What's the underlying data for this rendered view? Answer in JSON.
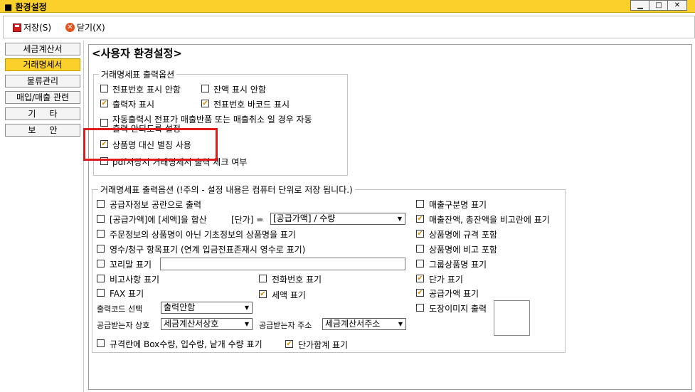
{
  "window": {
    "title": "환경설정"
  },
  "toolbar": {
    "save_label": "저장(S)",
    "close_label": "닫기(X)"
  },
  "nav": {
    "items": [
      {
        "label": "세금계산서",
        "active": false
      },
      {
        "label": "거래명세서",
        "active": true
      },
      {
        "label": "물류관리",
        "active": false
      },
      {
        "label": "매입/매출 관련",
        "active": false
      },
      {
        "label": "기     타",
        "active": false
      },
      {
        "label": "보     안",
        "active": false
      }
    ]
  },
  "page_title": "<사용자 환경설정>",
  "group1": {
    "legend": "거래명세표 출력옵션",
    "opts": {
      "no_slip_no": {
        "label": "전표번호 표시 안함",
        "checked": false
      },
      "no_balance": {
        "label": "잔액 표시 안함",
        "checked": false
      },
      "printer_show": {
        "label": "출력자 표시",
        "checked": true
      },
      "slip_barcode": {
        "label": "전표번호 바코드 표시",
        "checked": true
      },
      "auto_print": {
        "label": "자동출력시 전표가 매출반품 또는 매출취소 일 경우 자동",
        "checked": false
      },
      "auto_print_2": "출력 안되도록 설정",
      "alias": {
        "label": "상품명 대신 별칭 사용",
        "checked": true
      },
      "pdf_check": {
        "label": "pdf저장시 거래명세서 출력 체크 여부",
        "checked": false
      }
    }
  },
  "group2": {
    "legend": "거래명세표 출력옵션 (!주의 - 설정 내용은 컴퓨터 단위로 저장 됩니다.)",
    "left": {
      "supplier_blank": {
        "label": "공급자정보 공란으로 출력",
        "checked": false
      },
      "sum_amount": {
        "label": "[공급가액]에 [세액]을 합산",
        "checked": false
      },
      "unit_price_label": "[단가] =",
      "unit_price_formula": "[공급가액] / 수량",
      "order_basic_name": {
        "label": "주문정보의 상품명이 아닌 기초정보의 상품명을 표기",
        "checked": false
      },
      "receipt_claim": {
        "label": "영수/청구 항목표기 (연계 입금전표존재시 영수로 표기)",
        "checked": false
      },
      "footer_label": {
        "label": "꼬리말 표기",
        "checked": false
      },
      "footer_value": "",
      "remarks": {
        "label": "비고사항 표기",
        "checked": false
      },
      "phone": {
        "label": "전화번호 표기",
        "checked": false
      },
      "fax": {
        "label": "FAX 표기",
        "checked": false
      },
      "tax": {
        "label": "세액 표기",
        "checked": true
      },
      "print_code_label": "출력코드 선택",
      "print_code_value": "출력안함",
      "recv_name_label": "공급받는자 상호",
      "recv_name_value": "세금계산서상호",
      "recv_addr_label": "공급받는자 주소",
      "recv_addr_value": "세금계산서주소",
      "box_qty": {
        "label": "규격란에 Box수량, 입수량, 낱개 수량 표기",
        "checked": false
      },
      "unit_total": {
        "label": "단가합계 표기",
        "checked": true
      }
    },
    "right": {
      "sales_type": {
        "label": "매출구분명 표기",
        "checked": false
      },
      "balance_compare": {
        "label": "매출잔액, 총잔액을 비고란에 표기",
        "checked": true
      },
      "spec_in_name": {
        "label": "상품명에 규격 포함",
        "checked": true
      },
      "remark_in_name": {
        "label": "상품명에 비고 포함",
        "checked": false
      },
      "group_name": {
        "label": "그룹상품명 표기",
        "checked": false
      },
      "unit_price": {
        "label": "단가 표기",
        "checked": true
      },
      "supply_amount": {
        "label": "공급가액 표기",
        "checked": true
      },
      "stamp_image": {
        "label": "도장이미지 출력",
        "checked": false
      }
    }
  },
  "colors": {
    "titlebar": "#fbd02a",
    "highlight": "#e01b1b",
    "check": "#e08a00"
  }
}
